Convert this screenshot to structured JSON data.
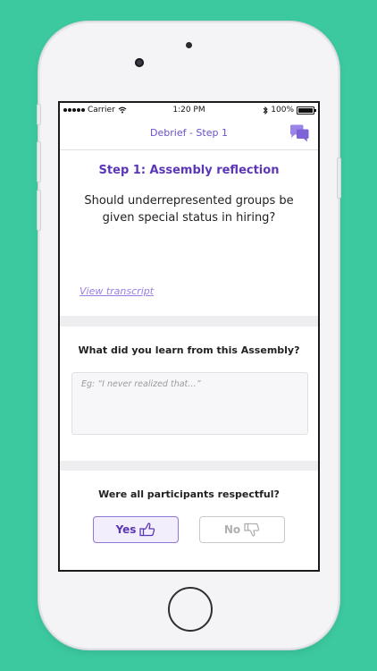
{
  "colors": {
    "background": "#3cc9a0",
    "accent": "#5b36b6",
    "nav_title": "#6a4fc8",
    "link": "#9a7ee6",
    "chat_icon": "#9b84e8"
  },
  "status_bar": {
    "carrier": "Carrier",
    "time": "1:20 PM",
    "battery": "100%"
  },
  "nav": {
    "title": "Debrief - Step 1",
    "icon": "chat-bubbles-icon"
  },
  "step": {
    "title": "Step 1: Assembly reflection",
    "question": "Should underrepresented groups be given special status in hiring?",
    "transcript_link": "View transcript"
  },
  "learn": {
    "label": "What did you learn from this Assembly?",
    "placeholder": "Eg: “I never realized that…”"
  },
  "respect": {
    "label": "Were all participants respectful?",
    "yes_label": "Yes",
    "no_label": "No",
    "selected": "Yes"
  }
}
